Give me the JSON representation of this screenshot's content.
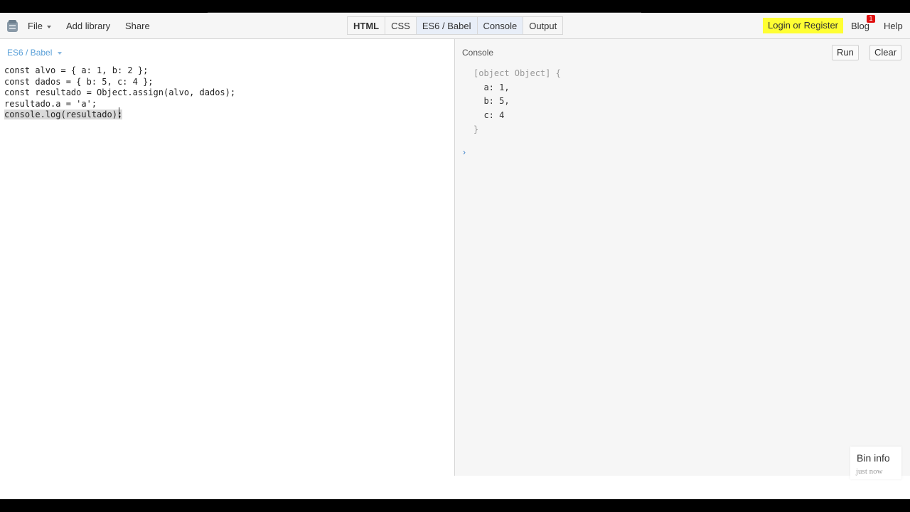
{
  "toolbar": {
    "file_label": "File",
    "add_library_label": "Add library",
    "share_label": "Share",
    "tabs": [
      {
        "label": "HTML"
      },
      {
        "label": "CSS"
      },
      {
        "label": "ES6 / Babel"
      },
      {
        "label": "Console"
      },
      {
        "label": "Output"
      }
    ],
    "login_label": "Login or Register",
    "blog_label": "Blog",
    "blog_badge": "1",
    "help_label": "Help"
  },
  "editor": {
    "language_label": "ES6 / Babel",
    "code_lines": [
      "const alvo = { a: 1, b: 2 };",
      "const dados = { b: 5, c: 4 };",
      "const resultado = Object.assign(alvo, dados);",
      "resultado.a = 'a';",
      "console.log(resultado);"
    ]
  },
  "console": {
    "label": "Console",
    "run_label": "Run",
    "clear_label": "Clear",
    "output_lines": [
      "[object Object] {",
      "  a: 1,",
      "  b: 5,",
      "  c: 4",
      "}"
    ],
    "prompt": "›"
  },
  "bin_info": {
    "title": "Bin info",
    "subtitle": "just now"
  },
  "colors": {
    "login_bg": "#ffff33",
    "active_tab_bg": "#e8eef8",
    "badge_bg": "#e01010",
    "editor_label": "#5aa0d8"
  }
}
